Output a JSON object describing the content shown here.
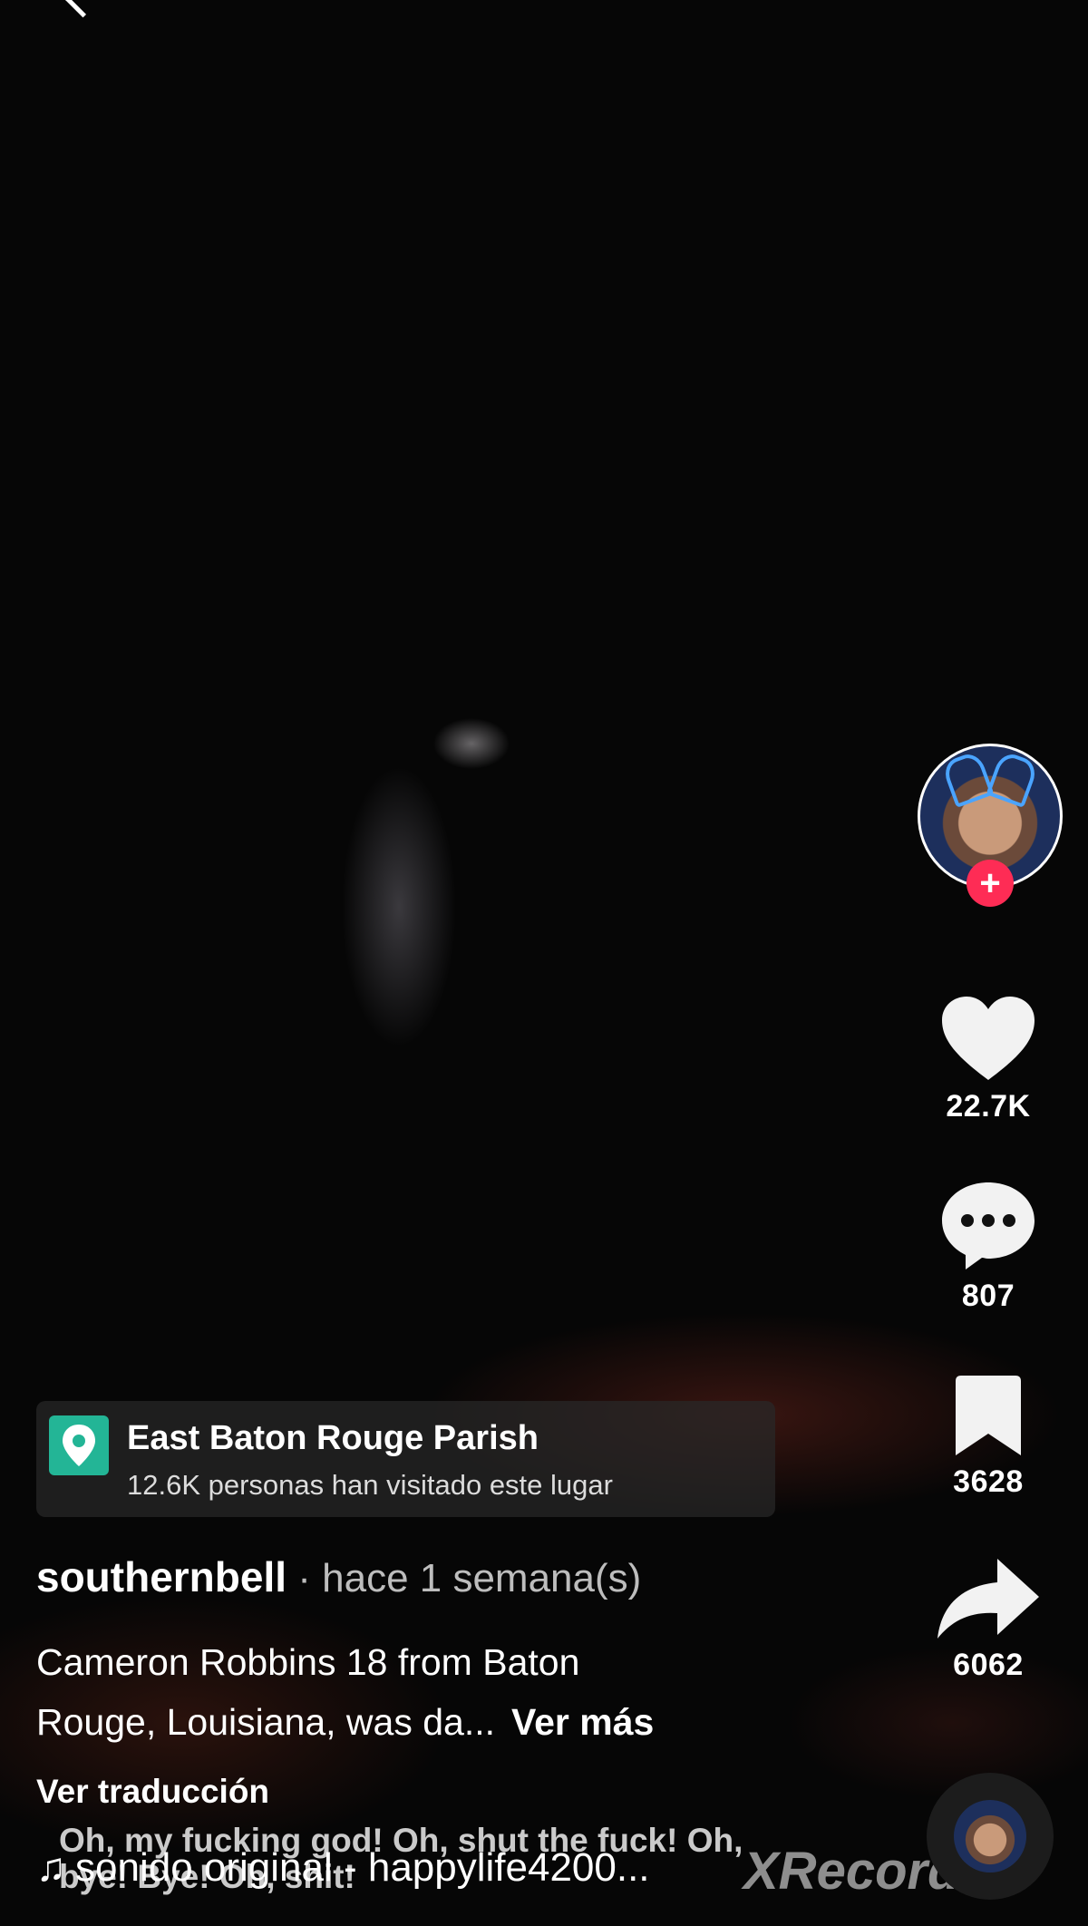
{
  "app": {
    "icons": {
      "back": "chevron-left-icon",
      "like": "heart-icon",
      "comment": "comment-bubble-icon",
      "bookmark": "bookmark-icon",
      "share": "share-arrow-icon",
      "location": "location-pin-icon",
      "music": "music-note-icon"
    },
    "colors": {
      "follow_accent": "#fe2c55",
      "location_icon_bg": "#23b596"
    }
  },
  "actions": {
    "follow_label": "+",
    "likes": "22.7K",
    "comments": "807",
    "bookmarks": "3628",
    "shares": "6062"
  },
  "location": {
    "name": "East Baton Rouge Parish",
    "visits": "12.6K personas han visitado este lugar"
  },
  "post": {
    "username": "southernbell",
    "timestamp": " · hace 1 semana(s)",
    "caption_line1": "Cameron Robbins 18 from Baton",
    "caption_line2": "Rouge, Louisiana, was da...",
    "see_more": "Ver más",
    "translate": "Ver traducción"
  },
  "video": {
    "subtitle_line1": "Oh, my fucking god! Oh, shut the fuck! Oh,",
    "subtitle_line2": "bye! Bye! Oh, shit!",
    "watermark": "XRecorder"
  },
  "music": {
    "note": "♫",
    "label": "sonido original - happylife4200..."
  }
}
